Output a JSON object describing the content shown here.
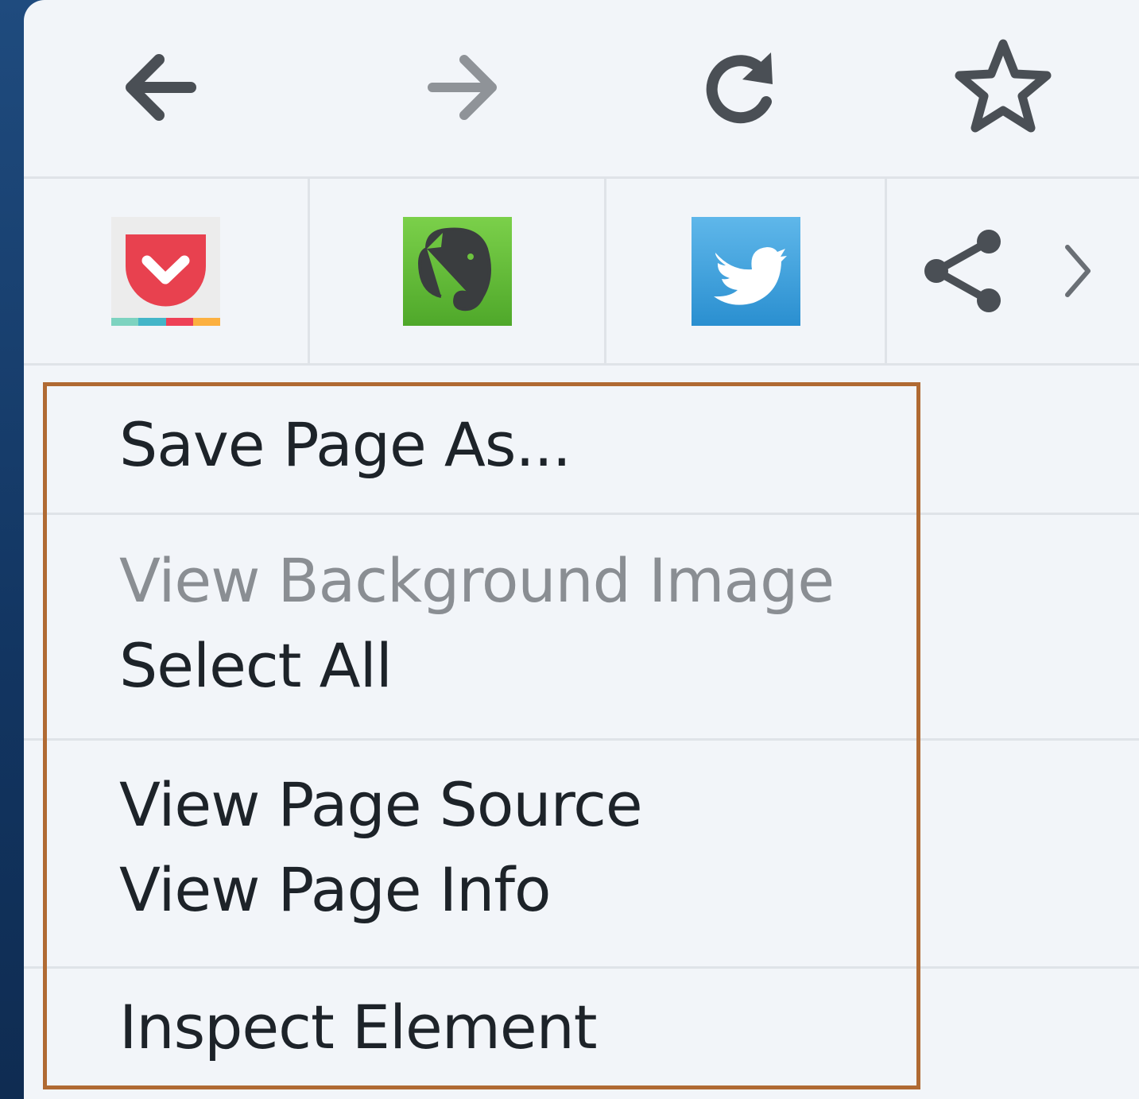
{
  "nav": {
    "back_icon": "arrow-left-icon",
    "forward_icon": "arrow-right-icon",
    "reload_icon": "reload-icon",
    "bookmark_icon": "star-icon"
  },
  "share": {
    "pocket_icon": "pocket-icon",
    "evernote_icon": "evernote-icon",
    "twitter_icon": "twitter-icon",
    "share_icon": "share-icon",
    "more_icon": "chevron-right-icon"
  },
  "menu_items": {
    "save_page_as": "Save Page As...",
    "view_background_image": "View Background Image",
    "select_all": "Select All",
    "view_page_source": "View Page Source",
    "view_page_info": "View Page Info",
    "inspect_element": "Inspect Element"
  },
  "colors": {
    "menu_bg": "#f2f5f9",
    "text": "#1d2329",
    "disabled_text": "#8a8e93",
    "highlight": "#b06a33",
    "backdrop": "#163a66"
  }
}
